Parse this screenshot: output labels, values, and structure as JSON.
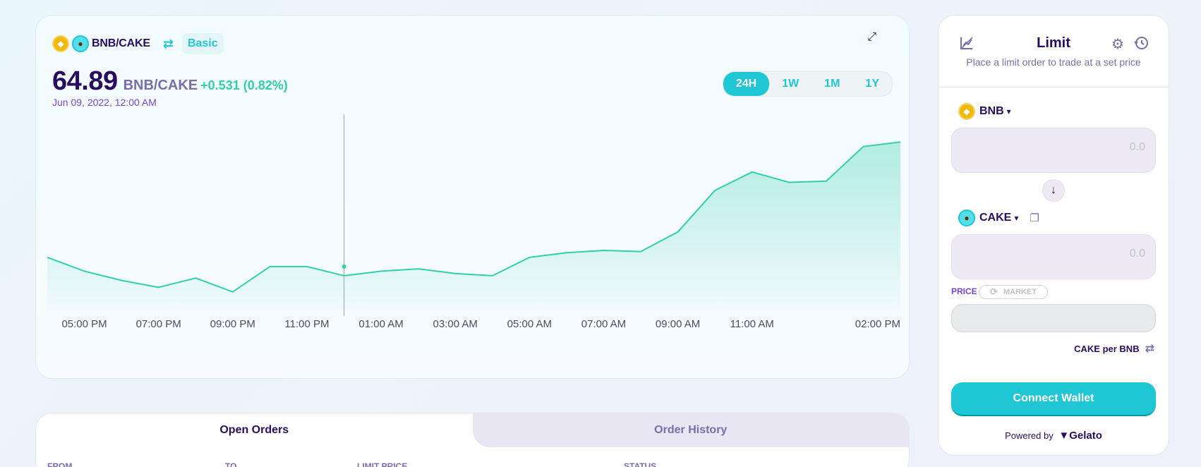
{
  "chart_header": {
    "pair": "BNB/CAKE",
    "mode": "Basic",
    "base_icon": "bnb-coin-icon",
    "quote_icon": "cake-coin-icon"
  },
  "price": {
    "value": "64.89",
    "pair": "BNB/CAKE",
    "change": "+0.531 (0.82%)",
    "date": "Jun 09, 2022, 12:00 AM"
  },
  "range_tabs": [
    "24H",
    "1W",
    "1M",
    "1Y"
  ],
  "active_range": "24H",
  "colors": {
    "accent": "#1fc7d4",
    "positive": "#31d0aa",
    "text_primary": "#280d5f",
    "text_secondary": "#7a6eaa"
  },
  "chart_data": {
    "type": "area",
    "x_ticks": [
      "05:00 PM",
      "07:00 PM",
      "09:00 PM",
      "11:00 PM",
      "01:00 AM",
      "03:00 AM",
      "05:00 AM",
      "07:00 AM",
      "09:00 AM",
      "11:00 AM",
      "02:00 PM"
    ],
    "x": [
      "04:00 PM",
      "05:00 PM",
      "06:00 PM",
      "07:00 PM",
      "08:00 PM",
      "09:00 PM",
      "10:00 PM",
      "11:00 PM",
      "12:00 AM",
      "01:00 AM",
      "02:00 AM",
      "03:00 AM",
      "04:00 AM",
      "05:00 AM",
      "06:00 AM",
      "07:00 AM",
      "08:00 AM",
      "09:00 AM",
      "10:00 AM",
      "11:00 AM",
      "12:00 PM",
      "01:00 PM",
      "02:00 PM"
    ],
    "values": [
      64.93,
      64.87,
      64.83,
      64.8,
      64.84,
      64.78,
      64.89,
      64.89,
      64.85,
      64.87,
      64.88,
      64.86,
      64.85,
      64.93,
      64.95,
      64.96,
      64.955,
      65.04,
      65.22,
      65.3,
      65.255,
      65.26,
      65.41,
      65.43
    ],
    "selected_x": "12:00 AM",
    "selected_value": 64.89,
    "ylim": [
      64.7,
      65.55
    ]
  },
  "orders": {
    "tabs": [
      "Open Orders",
      "Order History"
    ],
    "active_tab": "Open Orders",
    "columns": [
      "From",
      "To",
      "Limit Price",
      "Status"
    ]
  },
  "limit": {
    "title": "Limit",
    "subtitle": "Place a limit order to trade at a set price",
    "from_token": "BNB",
    "from_value": "0.0",
    "to_token": "CAKE",
    "to_value": "0.0",
    "price_label": "PRICE",
    "market_label": "MARKET",
    "price_value": "",
    "per_label": "CAKE per BNB",
    "connect_label": "Connect Wallet",
    "powered_label": "Powered by",
    "powered_brand": "Gelato"
  }
}
